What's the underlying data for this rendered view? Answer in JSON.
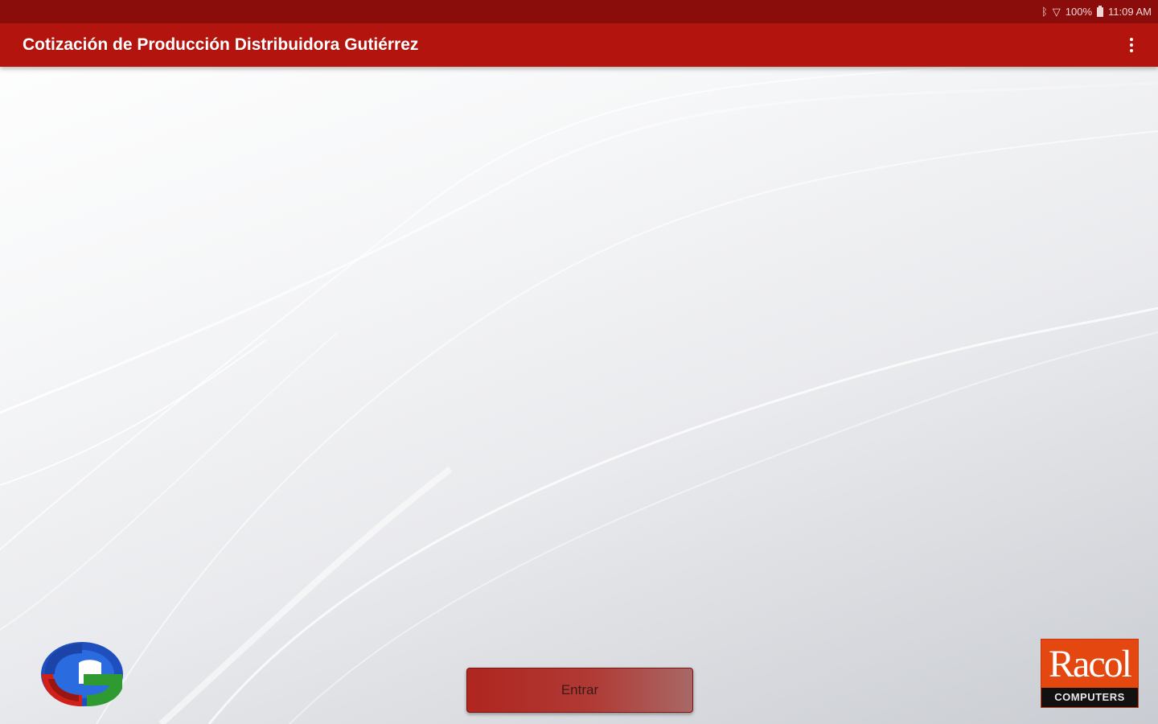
{
  "status_bar": {
    "bluetooth_icon": "bluetooth-icon",
    "signal_icon": "signal-icon",
    "battery_text": "100%",
    "battery_icon": "battery-icon",
    "time": "11:09 AM"
  },
  "app_bar": {
    "title": "Cotización de Producción Distribuidora Gutiérrez",
    "menu_icon": "more-vert-icon",
    "color": "#b3140e"
  },
  "main": {
    "enter_button_label": "Entrar"
  },
  "logos": {
    "left": "g-logo",
    "right_brand": "Racol",
    "right_sub": "COMPUTERS"
  },
  "colors": {
    "status_bar": "#8b0d0b",
    "app_bar": "#b3140e",
    "button": "#b0251f",
    "racol_orange": "#e4470f"
  }
}
